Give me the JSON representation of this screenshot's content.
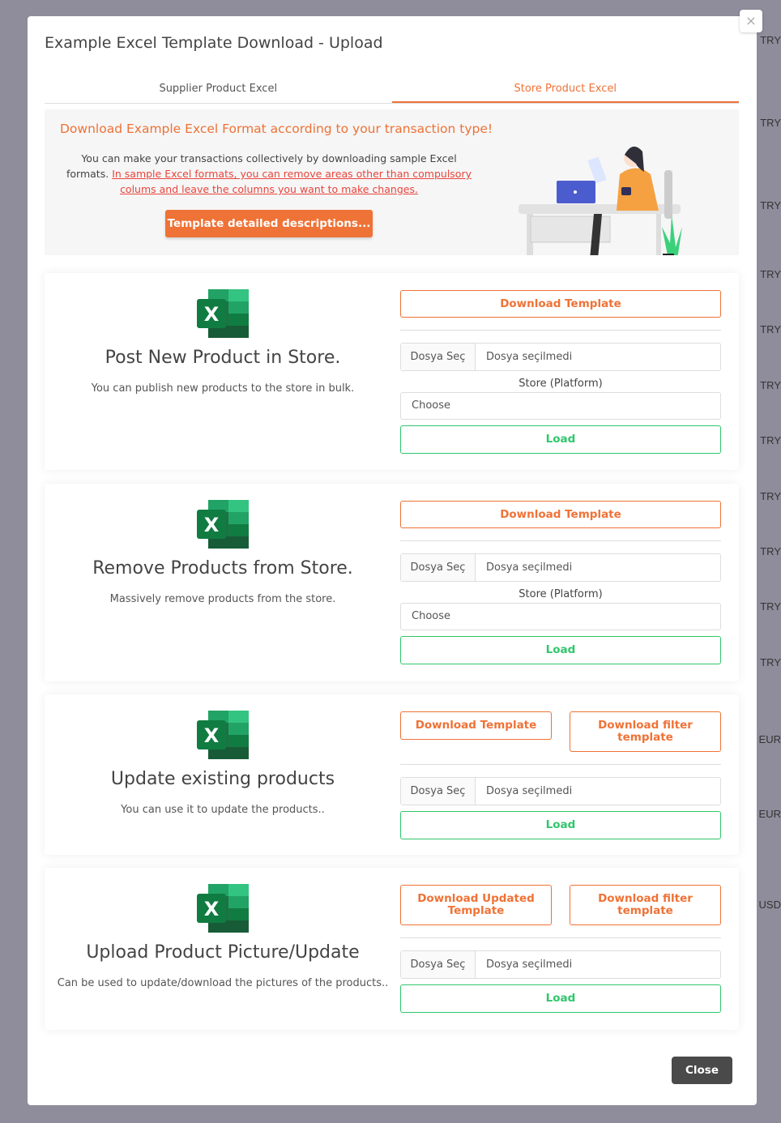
{
  "background": {
    "currencies": [
      "TRY",
      "TRY",
      "TRY",
      "TRY",
      "TRY",
      "TRY",
      "TRY",
      "TRY",
      "TRY",
      "TRY",
      "TRY",
      "EUR",
      "EUR",
      "USD"
    ]
  },
  "modal": {
    "title": "Example Excel Template Download - Upload",
    "close_x": "×",
    "tabs": [
      {
        "label": "Supplier Product Excel",
        "active": false
      },
      {
        "label": "Store Product Excel",
        "active": true
      }
    ],
    "banner": {
      "heading": "Download Example Excel Format according to your transaction type!",
      "text": "You can make your transactions collectively by downloading sample Excel formats.",
      "link": "In sample Excel formats, you can remove areas other than compulsory colums and leave the columns you want to make changes.",
      "button": "Template detailed descriptions..."
    },
    "cards": [
      {
        "title": "Post New Product in Store.",
        "desc": "You can publish new products to the store in bulk.",
        "buttons": [
          "Download Template"
        ],
        "file_button": "Dosya Seç",
        "file_name": "Dosya seçilmedi",
        "platform_label": "Store (Platform)",
        "select": "Choose",
        "load": "Load"
      },
      {
        "title": "Remove Products from Store.",
        "desc": "Massively remove products from the store.",
        "buttons": [
          "Download Template"
        ],
        "file_button": "Dosya Seç",
        "file_name": "Dosya seçilmedi",
        "platform_label": "Store (Platform)",
        "select": "Choose",
        "load": "Load"
      },
      {
        "title": "Update existing products",
        "desc": "You can use it to update the products..",
        "buttons": [
          "Download Template",
          "Download filter template"
        ],
        "file_button": "Dosya Seç",
        "file_name": "Dosya seçilmedi",
        "load": "Load"
      },
      {
        "title": "Upload Product Picture/Update",
        "desc": "Can be used to update/download the pictures of the products..",
        "buttons": [
          "Download Updated Template",
          "Download filter template"
        ],
        "file_button": "Dosya Seç",
        "file_name": "Dosya seçilmedi",
        "load": "Load"
      }
    ],
    "close_button": "Close",
    "colors": {
      "accent": "#ef7236",
      "success": "#2fc76b",
      "link": "#e8453c"
    }
  }
}
